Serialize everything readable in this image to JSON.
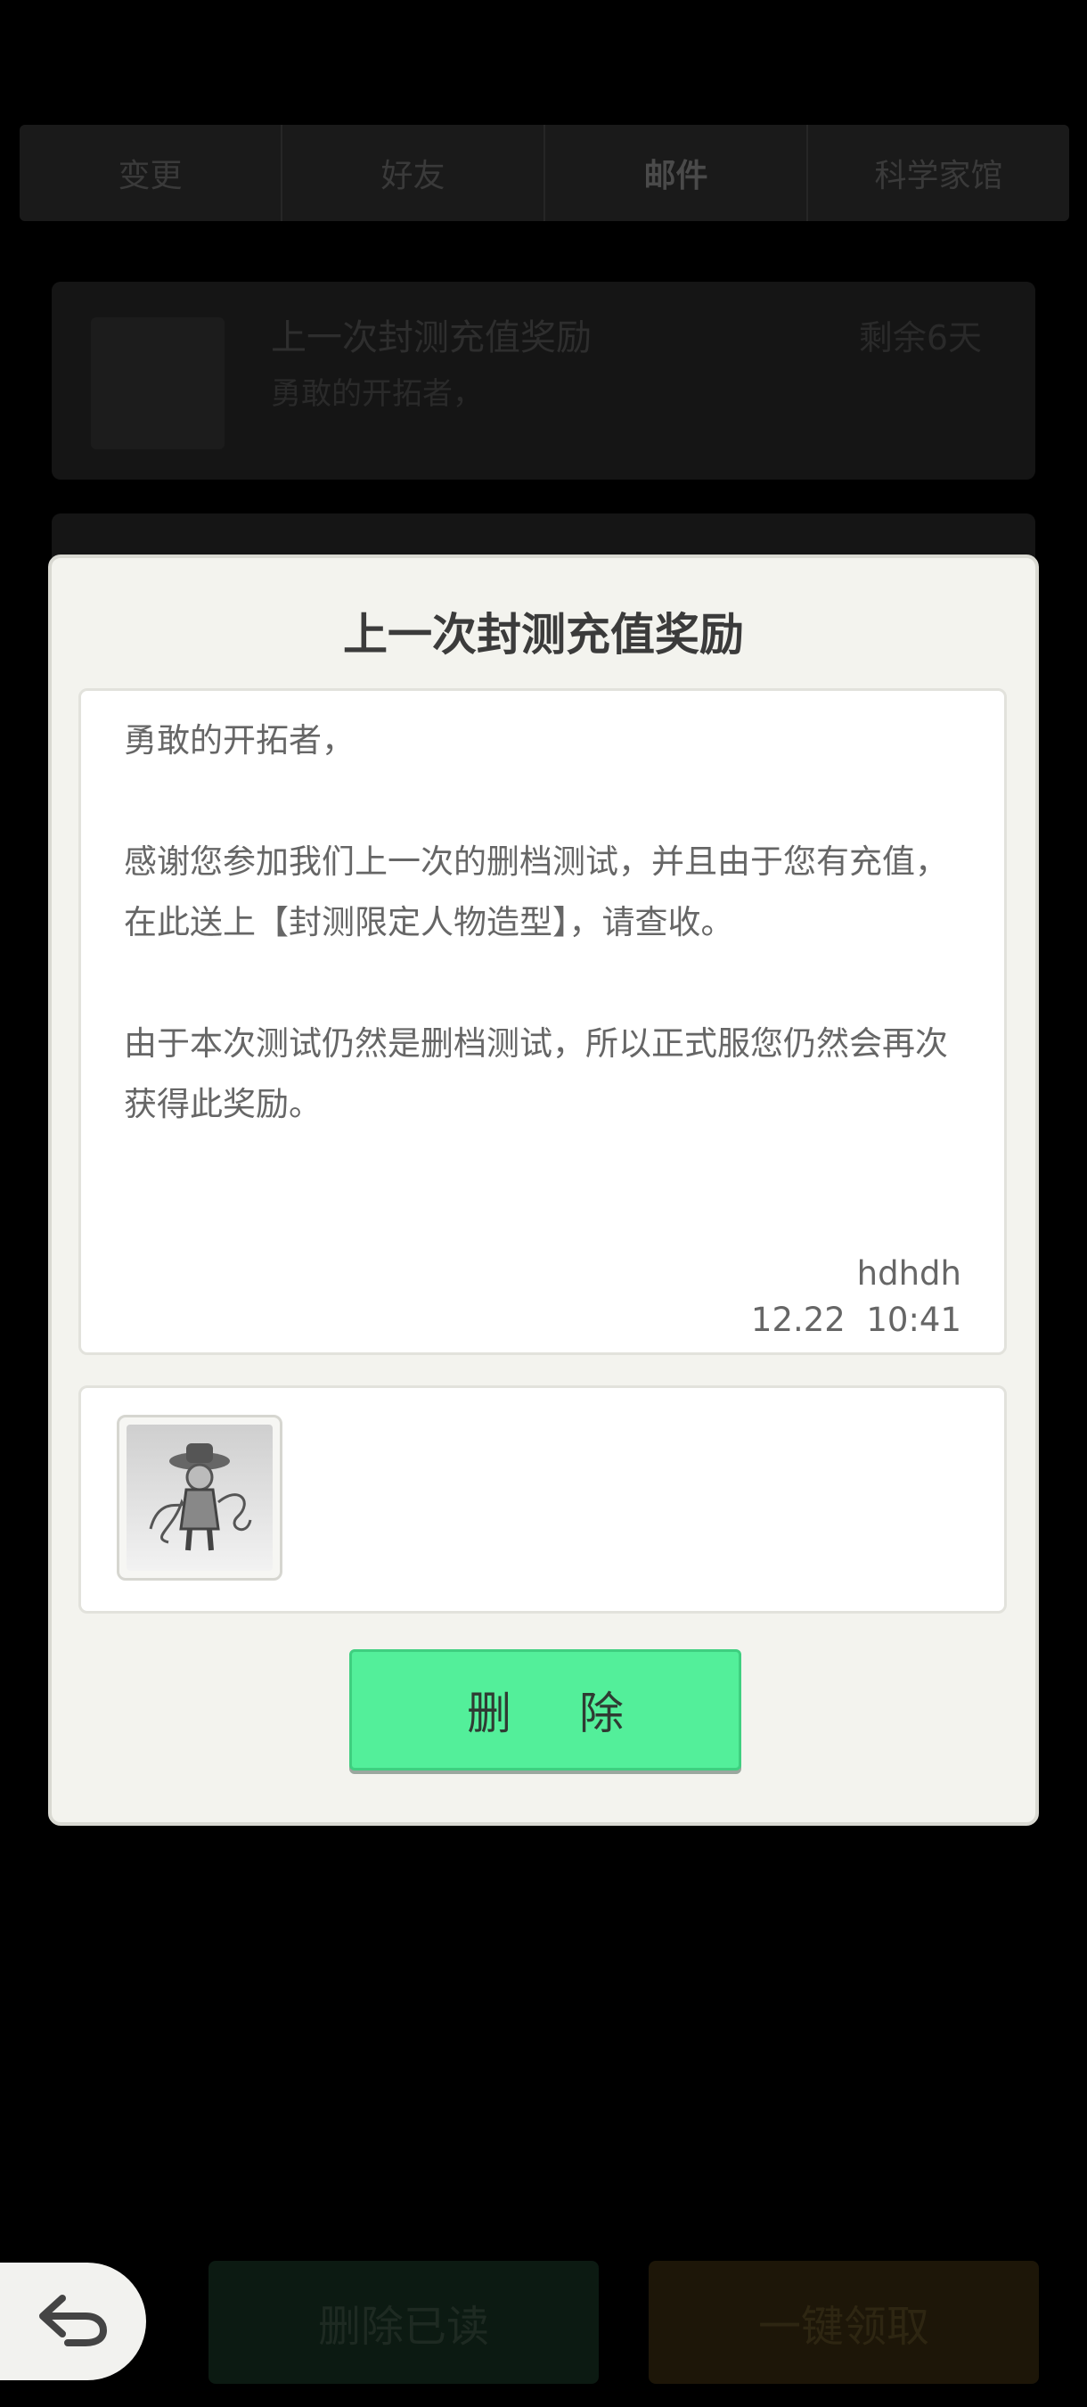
{
  "tabs": [
    {
      "label": "变更"
    },
    {
      "label": "好友"
    },
    {
      "label": "邮件"
    },
    {
      "label": "科学家馆"
    }
  ],
  "mail_list": [
    {
      "title": "上一次封测充值奖励",
      "preview": "勇敢的开拓者，",
      "days_left": "剩余6天"
    }
  ],
  "dialog": {
    "title": "上一次封测充值奖励",
    "body": [
      "勇敢的开拓者，",
      "",
      "感谢您参加我们上一次的删档测试，并且由于您有充值，在此送上【封测限定人物造型】，请查收。",
      "",
      "由于本次测试仍然是删档测试，所以正式服您仍然会再次获得此奖励。"
    ],
    "sender": "hdhdh",
    "time": "12.22  10:41",
    "delete_label": "删 除"
  },
  "bottom": {
    "delete_read_label": "删除已读",
    "claim_all_label": "一键领取"
  },
  "colors": {
    "accent_green": "#53ef9a",
    "dialog_bg": "#f3f3ee"
  }
}
